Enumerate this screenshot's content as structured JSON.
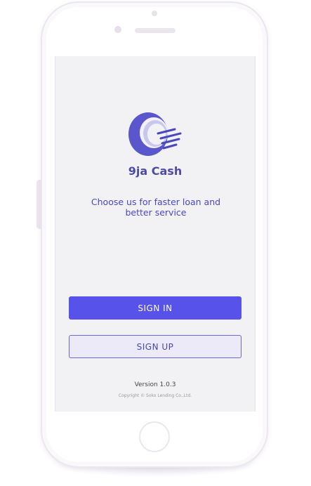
{
  "app": {
    "name": "9ja Cash",
    "tagline": "Choose us for faster loan and better service",
    "version": "Version 1.0.3",
    "copyright": "Copyright © Soko Lending Co.,Ltd."
  },
  "buttons": {
    "signin_label": "SIGN IN",
    "signup_label": "SIGN UP"
  },
  "icons": {
    "logo": "q-speed-logo-icon"
  },
  "colors": {
    "primary": "#5652ea",
    "brand_text": "#4f4aa8",
    "secondary_bg": "#ece9f8",
    "screen_bg": "#f2f2f5"
  }
}
